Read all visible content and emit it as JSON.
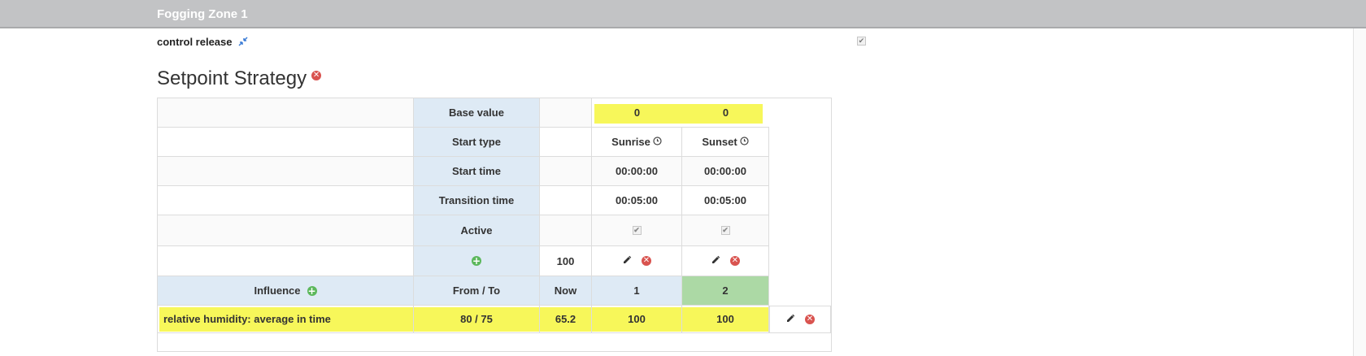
{
  "header": {
    "title": "Fogging Zone 1"
  },
  "control_release": {
    "label": "control release",
    "icon": "compress-arrows-icon",
    "checked": true
  },
  "section": {
    "title": "Setpoint Strategy",
    "remove_icon": "remove-circle-icon"
  },
  "strategy": {
    "base_value": {
      "label": "Base value",
      "values": [
        "0",
        "0"
      ]
    },
    "start_type": {
      "label": "Start type",
      "values": [
        "Sunrise",
        "Sunset"
      ]
    },
    "start_time": {
      "label": "Start time",
      "values": [
        "00:00:00",
        "00:00:00"
      ]
    },
    "transition_time": {
      "label": "Transition time",
      "values": [
        "00:05:00",
        "00:05:00"
      ]
    },
    "active": {
      "label": "Active",
      "values": [
        true,
        true
      ]
    },
    "add_row": {
      "now_value": "100"
    }
  },
  "influence": {
    "header": {
      "label": "Influence",
      "from_to": "From / To",
      "now": "Now",
      "columns": [
        "1",
        "2"
      ]
    },
    "rows": [
      {
        "name": "relative humidity: average in time",
        "from_to": "80 / 75",
        "now": "65.2",
        "values": [
          "100",
          "100"
        ]
      }
    ]
  },
  "colors": {
    "highlight": "#f7f75a",
    "label_bg": "#deeaf5",
    "active_column": "#acd9a5",
    "header_bar": "#c2c3c5"
  }
}
